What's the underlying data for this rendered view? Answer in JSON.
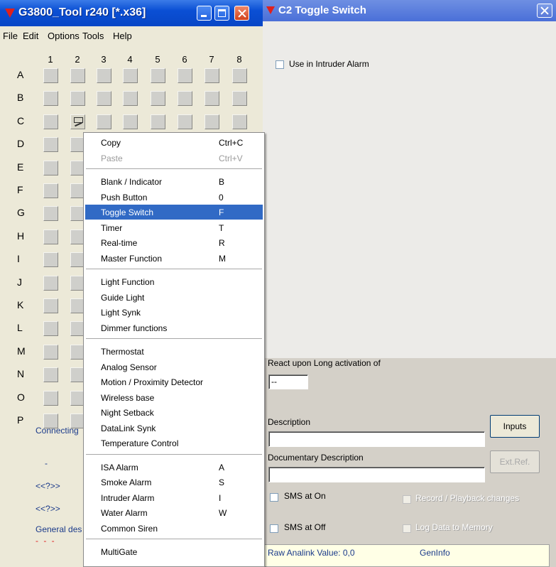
{
  "left_window": {
    "title": "G3800_Tool r240 [*.x36]",
    "menu": [
      "File",
      "Edit",
      "Options",
      "Tools",
      "Help"
    ],
    "columns": [
      "1",
      "2",
      "3",
      "4",
      "5",
      "6",
      "7",
      "8"
    ],
    "rows": [
      "A",
      "B",
      "C",
      "D",
      "E",
      "F",
      "G",
      "H",
      "I",
      "J",
      "K",
      "L",
      "M",
      "N",
      "O",
      "P"
    ],
    "connecting_text": "Connecting",
    "dash_text": "-",
    "link_1": "<<?>>",
    "link_2": "<<?>>",
    "general_text": "General des",
    "red_dashes": "- - -"
  },
  "context_menu": {
    "groups": [
      [
        {
          "label": "Copy",
          "shortcut": "Ctrl+C",
          "disabled": false
        },
        {
          "label": "Paste",
          "shortcut": "Ctrl+V",
          "disabled": true
        }
      ],
      [
        {
          "label": "Blank / Indicator",
          "shortcut": "B"
        },
        {
          "label": "Push Button",
          "shortcut": "0"
        },
        {
          "label": "Toggle Switch",
          "shortcut": "F",
          "selected": true
        },
        {
          "label": "Timer",
          "shortcut": "T"
        },
        {
          "label": "Real-time",
          "shortcut": "R"
        },
        {
          "label": "Master Function",
          "shortcut": "M"
        }
      ],
      [
        {
          "label": "Light Function",
          "shortcut": ""
        },
        {
          "label": "Guide Light",
          "shortcut": ""
        },
        {
          "label": "Light Synk",
          "shortcut": ""
        },
        {
          "label": "Dimmer functions",
          "shortcut": ""
        }
      ],
      [
        {
          "label": "Thermostat",
          "shortcut": ""
        },
        {
          "label": "Analog Sensor",
          "shortcut": ""
        },
        {
          "label": "Motion / Proximity Detector",
          "shortcut": ""
        },
        {
          "label": "Wireless base",
          "shortcut": ""
        },
        {
          "label": "Night Setback",
          "shortcut": ""
        },
        {
          "label": "DataLink Synk",
          "shortcut": ""
        },
        {
          "label": "Temperature Control",
          "shortcut": ""
        }
      ],
      [
        {
          "label": "ISA Alarm",
          "shortcut": "A"
        },
        {
          "label": "Smoke Alarm",
          "shortcut": "S"
        },
        {
          "label": "Intruder Alarm",
          "shortcut": "I"
        },
        {
          "label": "Water Alarm",
          "shortcut": "W"
        },
        {
          "label": "Common Siren",
          "shortcut": ""
        }
      ],
      [
        {
          "label": "MultiGate",
          "shortcut": ""
        }
      ]
    ]
  },
  "right_window": {
    "title": "C2   Toggle Switch",
    "use_intruder_label": "Use in Intruder Alarm",
    "react_label": "React upon Long activation of",
    "react_value": "--",
    "description_label": "Description",
    "description_value": "",
    "inputs_button": "Inputs",
    "doc_description_label": "Documentary Description",
    "doc_description_value": "",
    "extref_button": "Ext.Ref.",
    "sms_on_label": "SMS at On",
    "sms_off_label": "SMS at Off",
    "record_label": "Record / Playback changes",
    "log_label": "Log Data to Memory",
    "raw_label": "Raw Analink Value: 0,0",
    "geninfo_label": "GenInfo"
  }
}
